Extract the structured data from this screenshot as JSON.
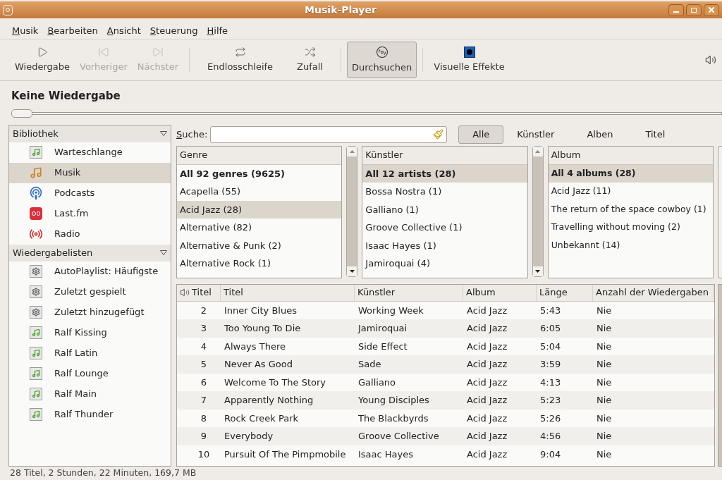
{
  "window": {
    "title": "Musik-Player"
  },
  "menu": [
    "Musik",
    "Bearbeiten",
    "Ansicht",
    "Steuerung",
    "Hilfe"
  ],
  "toolbar": [
    [
      {
        "label": "Wiedergabe",
        "kind": "play",
        "disabled": false,
        "selected": false
      },
      {
        "label": "Vorheriger",
        "kind": "previous",
        "disabled": true,
        "selected": false
      },
      {
        "label": "Nächster",
        "kind": "next",
        "disabled": true,
        "selected": false
      }
    ],
    [
      {
        "label": "Endlosschleife",
        "kind": "repeat",
        "disabled": false,
        "selected": false
      },
      {
        "label": "Zufall",
        "kind": "shuffle",
        "disabled": false,
        "selected": false
      }
    ],
    [
      {
        "label": "Durchsuchen",
        "kind": "browse",
        "disabled": false,
        "selected": true
      }
    ],
    [
      {
        "label": "Visuelle Effekte",
        "kind": "visual",
        "disabled": false,
        "selected": false
      }
    ]
  ],
  "now_playing": "Keine Wiedergabe",
  "seek": {
    "level": 0
  },
  "sidebar": [
    {
      "title": "Bibliothek",
      "expanded": true,
      "items": [
        {
          "label": "Warteschlange",
          "kind": "queue",
          "selected": false
        },
        {
          "label": "Musik",
          "kind": "music",
          "selected": true
        },
        {
          "label": "Podcasts",
          "kind": "podcast",
          "selected": false
        },
        {
          "label": "Last.fm",
          "kind": "lastfm",
          "selected": false
        },
        {
          "label": "Radio",
          "kind": "radio",
          "selected": false
        }
      ]
    },
    {
      "title": "Wiedergabelisten",
      "expanded": true,
      "items": [
        {
          "label": "AutoPlaylist: Häufigste",
          "kind": "auto",
          "selected": false
        },
        {
          "label": "Zuletzt gespielt",
          "kind": "auto",
          "selected": false
        },
        {
          "label": "Zuletzt hinzugefügt",
          "kind": "auto",
          "selected": false
        },
        {
          "label": "Ralf Kissing",
          "kind": "playlist",
          "selected": false
        },
        {
          "label": "Ralf Latin",
          "kind": "playlist",
          "selected": false
        },
        {
          "label": "Ralf Lounge",
          "kind": "playlist",
          "selected": false
        },
        {
          "label": "Ralf Main",
          "kind": "playlist",
          "selected": false
        },
        {
          "label": "Ralf Thunder",
          "kind": "playlist",
          "selected": false
        }
      ]
    }
  ],
  "search": {
    "label": "Suche:",
    "filters": [
      {
        "label": "Alle",
        "selected": true
      },
      {
        "label": "Künstler",
        "selected": false
      },
      {
        "label": "Alben",
        "selected": false
      },
      {
        "label": "Titel",
        "selected": false
      }
    ]
  },
  "browser": [
    {
      "header": "Genre",
      "rows": [
        {
          "label": "All 92 genres (9625)",
          "kind": "all",
          "selected": false
        },
        {
          "label": "Acapella (55)",
          "kind": "entry",
          "selected": false
        },
        {
          "label": "Acid Jazz (28)",
          "kind": "entry",
          "selected": true
        },
        {
          "label": "Alternative (82)",
          "kind": "entry",
          "selected": false
        },
        {
          "label": "Alternative & Punk (2)",
          "kind": "entry",
          "selected": false
        },
        {
          "label": "Alternative Rock (1)",
          "kind": "entry",
          "selected": false
        }
      ]
    },
    {
      "header": "Künstler",
      "rows": [
        {
          "label": "All 12 artists (28)",
          "kind": "all",
          "selected": true
        },
        {
          "label": "Bossa Nostra (1)",
          "kind": "entry",
          "selected": false
        },
        {
          "label": "Galliano (1)",
          "kind": "entry",
          "selected": false
        },
        {
          "label": "Groove Collective (1)",
          "kind": "entry",
          "selected": false
        },
        {
          "label": "Isaac Hayes (1)",
          "kind": "entry",
          "selected": false
        },
        {
          "label": "Jamiroquai (4)",
          "kind": "entry",
          "selected": false
        }
      ]
    },
    {
      "header": "Album",
      "rows": [
        {
          "label": "All 4 albums (28)",
          "kind": "all",
          "selected": true
        },
        {
          "label": "Acid Jazz (11)",
          "kind": "entry",
          "selected": false
        },
        {
          "label": "The return of the space cowboy (1)",
          "kind": "entry",
          "selected": false
        },
        {
          "label": "Travelling without moving (2)",
          "kind": "entry",
          "selected": false
        },
        {
          "label": "Unbekannt (14)",
          "kind": "entry",
          "selected": false
        }
      ]
    }
  ],
  "tracks": {
    "columns": [
      "Titel",
      "Titel",
      "Künstler",
      "Album",
      "Länge",
      "Anzahl der Wiedergaben"
    ],
    "rows": [
      [
        "2",
        "Inner City Blues",
        "Working Week",
        "Acid Jazz",
        "5:43",
        "Nie"
      ],
      [
        "3",
        "Too Young To Die",
        "Jamiroquai",
        "Acid Jazz",
        "6:05",
        "Nie"
      ],
      [
        "4",
        "Always There",
        "Side Effect",
        "Acid Jazz",
        "5:04",
        "Nie"
      ],
      [
        "5",
        "Never As Good",
        "Sade",
        "Acid Jazz",
        "3:59",
        "Nie"
      ],
      [
        "6",
        "Welcome To The Story",
        "Galliano",
        "Acid Jazz",
        "4:13",
        "Nie"
      ],
      [
        "7",
        "Apparently Nothing",
        "Young Disciples",
        "Acid Jazz",
        "5:23",
        "Nie"
      ],
      [
        "8",
        "Rock Creek Park",
        "The Blackbyrds",
        "Acid Jazz",
        "5:26",
        "Nie"
      ],
      [
        "9",
        "Everybody",
        "Groove Collective",
        "Acid Jazz",
        "4:56",
        "Nie"
      ],
      [
        "10",
        "Pursuit Of The Pimpmobile",
        "Isaac Hayes",
        "Acid Jazz",
        "9:04",
        "Nie"
      ]
    ]
  },
  "status_bar": "28 Titel, 2 Stunden, 22 Minuten, 169,7 MB"
}
